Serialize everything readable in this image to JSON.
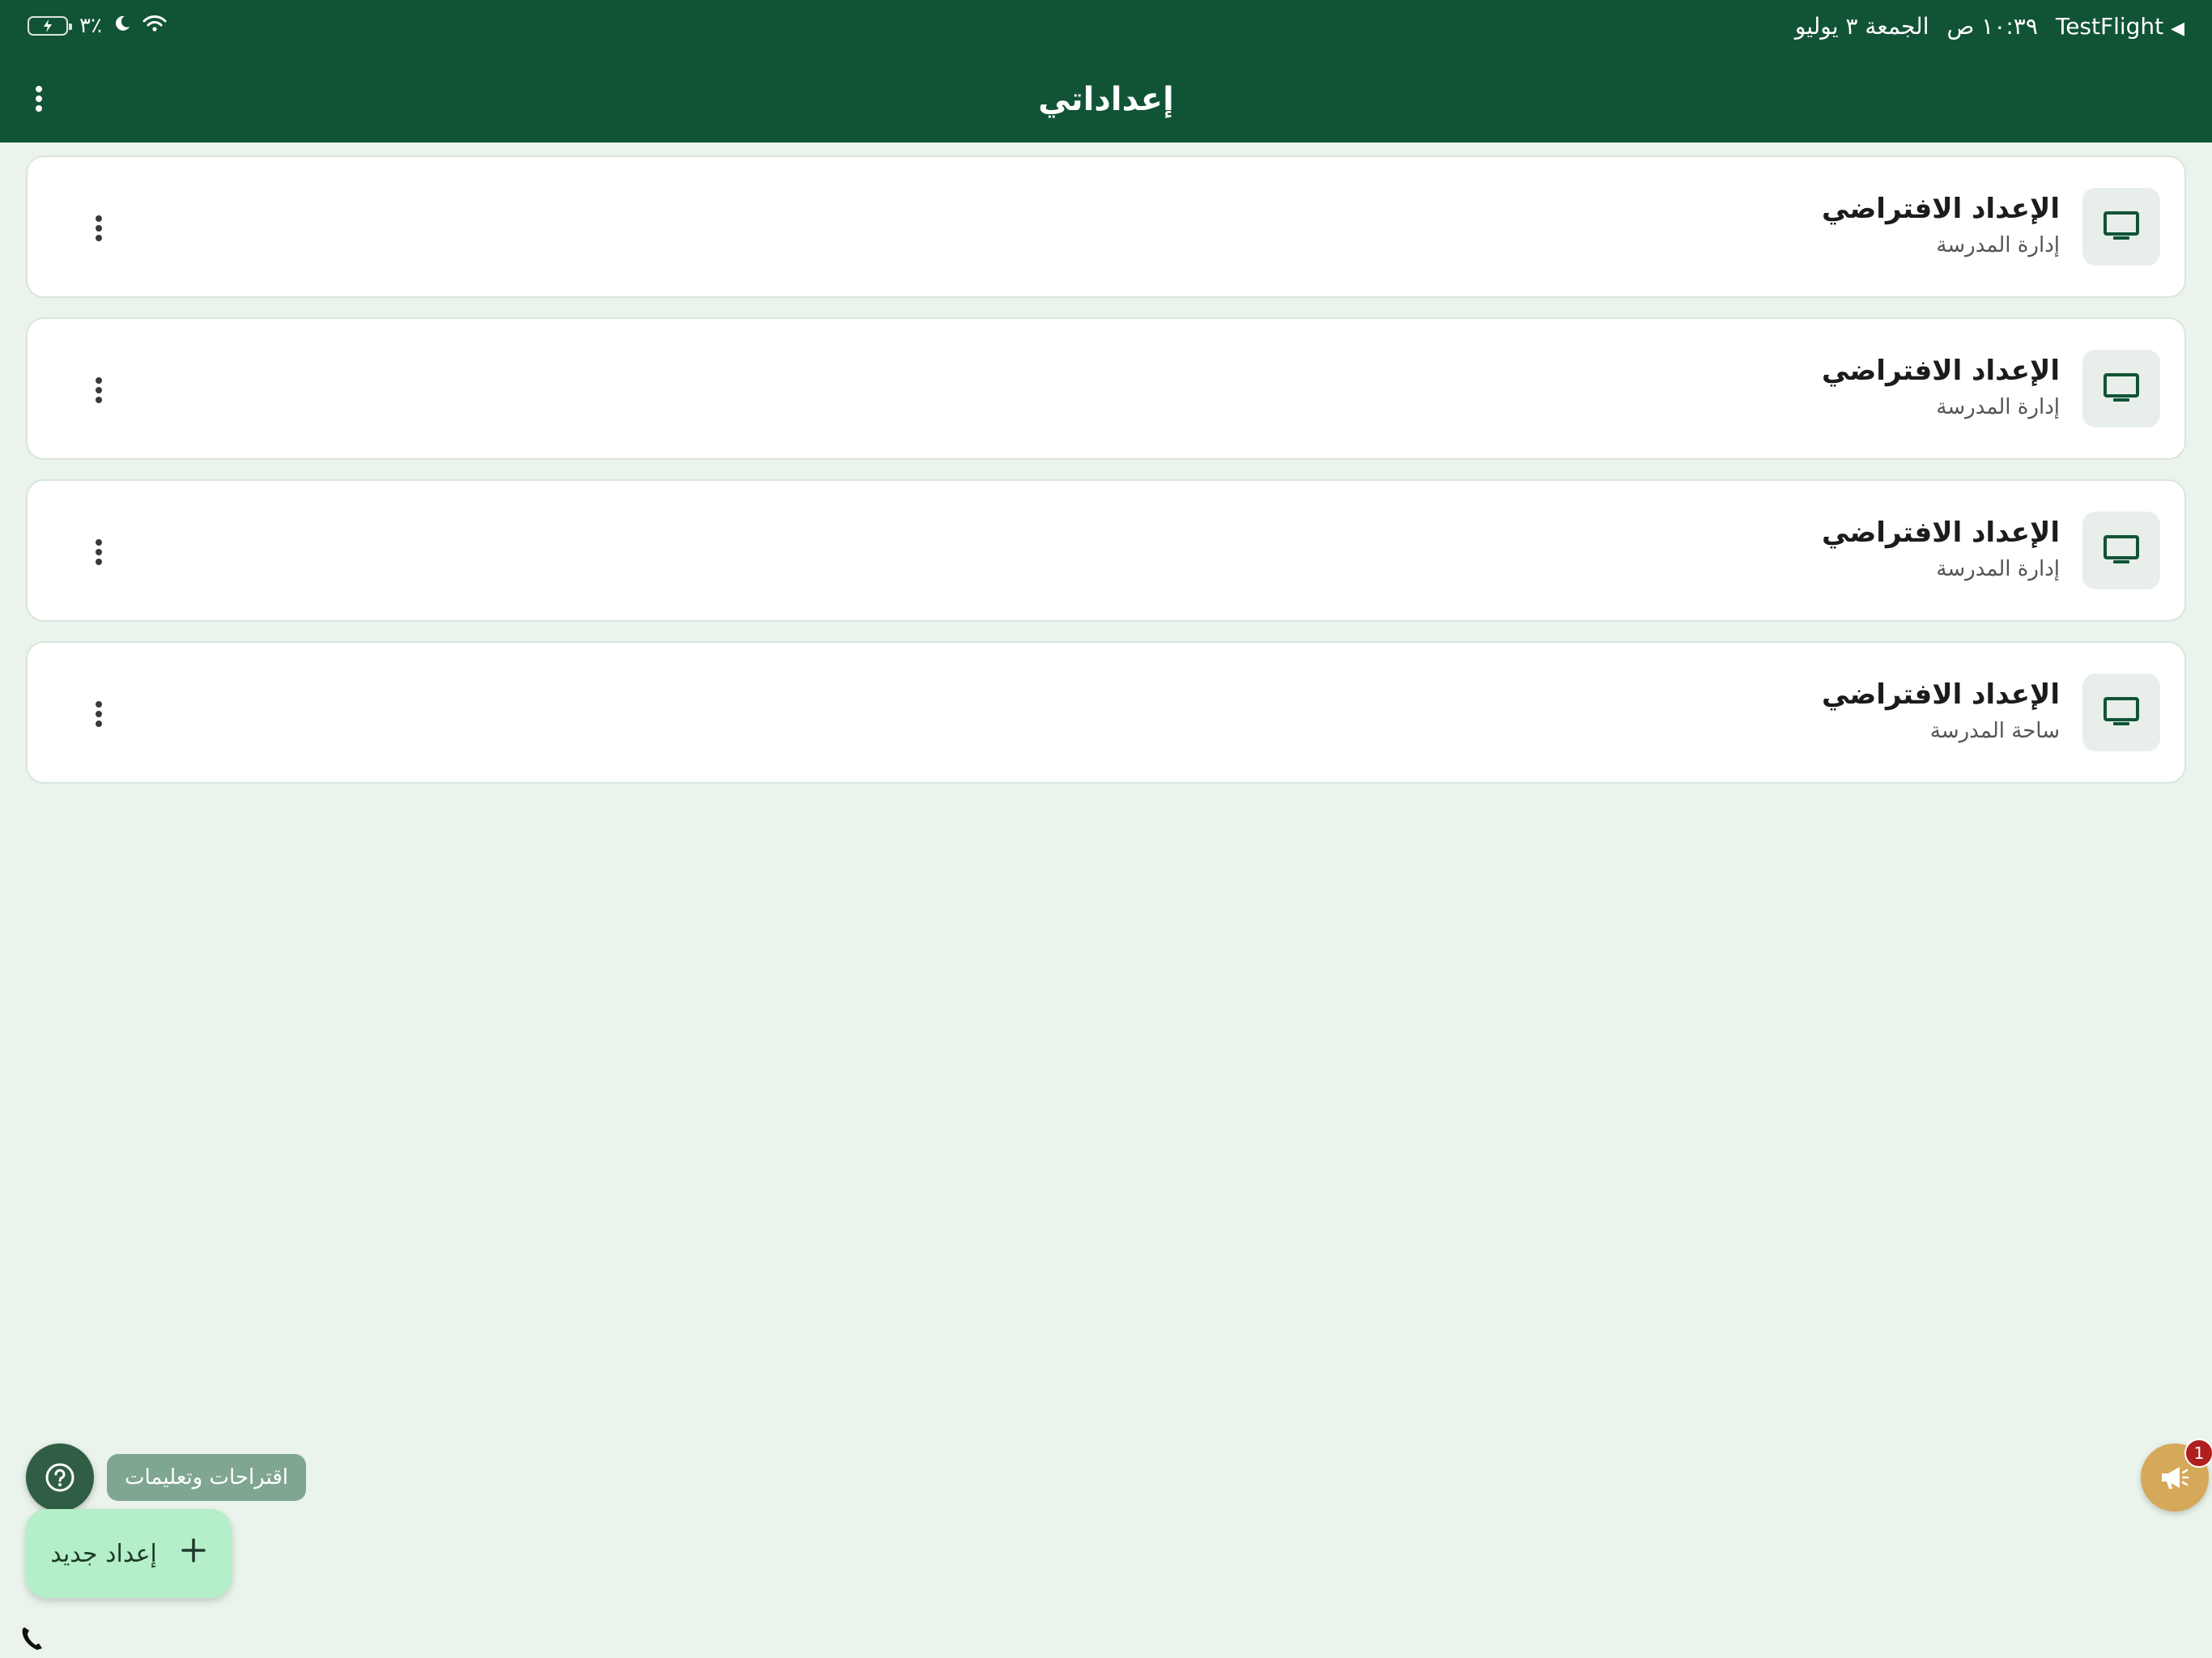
{
  "status_bar": {
    "app_back": "TestFlight",
    "time": "١٠:٣٩ ص",
    "date": "الجمعة ٣ يوليو",
    "battery": "٣٪"
  },
  "app_bar": {
    "title": "إعداداتي"
  },
  "settings": [
    {
      "title": "الإعداد الافتراضي",
      "subtitle": "إدارة المدرسة"
    },
    {
      "title": "الإعداد الافتراضي",
      "subtitle": "إدارة المدرسة"
    },
    {
      "title": "الإعداد الافتراضي",
      "subtitle": "إدارة المدرسة"
    },
    {
      "title": "الإعداد الافتراضي",
      "subtitle": "ساحة المدرسة"
    }
  ],
  "help": {
    "label": "اقتراحات وتعليمات"
  },
  "new_setting": {
    "label": "إعداد جديد"
  },
  "announcements": {
    "badge_count": "1"
  },
  "colors": {
    "app_bar": "#115435",
    "background": "#EAF4EC",
    "fab": "#B4EFC9",
    "announce": "#D6A85A",
    "badge": "#B01E1E"
  },
  "icons": {
    "setting_item": "monitor-icon",
    "menu": "more-vertical-icon",
    "help": "question-icon",
    "add": "plus-icon",
    "announce": "megaphone-icon",
    "phone": "phone-icon"
  }
}
